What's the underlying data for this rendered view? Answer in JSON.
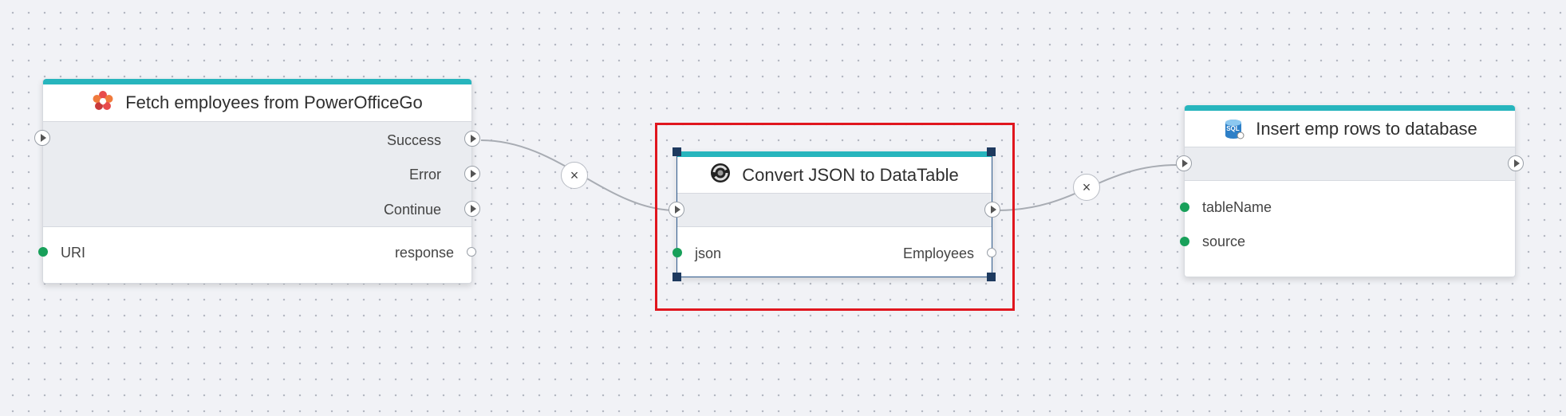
{
  "nodes": {
    "fetch": {
      "title": "Fetch employees from PowerOfficeGo",
      "outputs": [
        "Success",
        "Error",
        "Continue"
      ],
      "input_param": "URI",
      "output_param": "response"
    },
    "convert": {
      "title": "Convert JSON to DataTable",
      "input_param": "json",
      "output_param": "Employees"
    },
    "insert": {
      "title": "Insert emp rows to database",
      "icon_text": "SQL",
      "params": [
        "tableName",
        "source"
      ]
    }
  },
  "colors": {
    "accent": "#27b5bd",
    "selection": "#e0161e",
    "param_dot": "#18a05a",
    "handle": "#1e3a5f"
  },
  "icons": {
    "fetch": "poweroffice-flower-icon",
    "convert": "json-icon",
    "insert": "sql-database-icon",
    "connection_remove": "close-icon"
  },
  "connection_remove_glyph": "×"
}
